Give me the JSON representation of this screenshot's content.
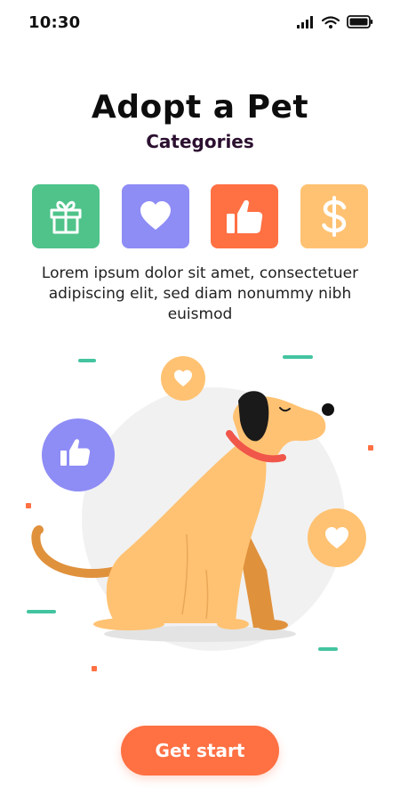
{
  "status_bar": {
    "time": "10:30",
    "icons": [
      "signal-icon",
      "wifi-icon",
      "battery-icon"
    ]
  },
  "header": {
    "title": "Adopt a Pet",
    "subtitle": "Categories"
  },
  "categories": [
    {
      "icon": "gift-icon",
      "color": "#4fc38a"
    },
    {
      "icon": "heart-icon",
      "color": "#8e8cf5"
    },
    {
      "icon": "thumbs-up-icon",
      "color": "#ff7043"
    },
    {
      "icon": "dollar-icon",
      "color": "#ffc272"
    }
  ],
  "description": "Lorem ipsum dolor sit amet, consectetuer adipiscing elit, sed diam nonummy nibh euismod",
  "illustration": {
    "subject": "sitting-dog",
    "badges": [
      "heart-icon",
      "thumbs-up-icon",
      "heart-icon"
    ]
  },
  "cta": {
    "label": "Get start",
    "color": "#ff7043"
  }
}
